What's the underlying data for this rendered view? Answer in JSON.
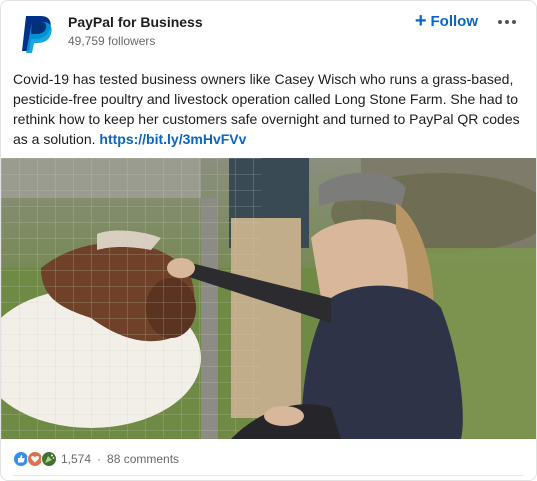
{
  "post": {
    "author": {
      "name": "PayPal for Business",
      "followers": "49,759 followers",
      "logo_icon": "paypal-logo-icon",
      "brand_colors": [
        "#003087",
        "#009cde"
      ]
    },
    "actions": {
      "follow_label": "Follow",
      "follow_icon": "plus-icon",
      "more_icon": "ellipsis-icon"
    },
    "text": "Covid-19 has tested business owners like Casey Wisch who runs a grass-based, pesticide-free poultry and livestock operation called Long Stone Farm. She had to rethink how to keep her customers safe overnight and turned to PayPal QR codes as a solution. ",
    "link": "https://bit.ly/3mHvFVv",
    "media": {
      "kind": "photo",
      "icon": "farm-photo"
    },
    "social": {
      "reaction_icons": [
        "like-icon",
        "love-icon",
        "celebrate-icon"
      ],
      "reactions_count": "1,574",
      "separator": "·",
      "comments": "88 comments"
    },
    "colors": {
      "accent": "#0a66c2",
      "muted": "#6a6a6a"
    }
  }
}
